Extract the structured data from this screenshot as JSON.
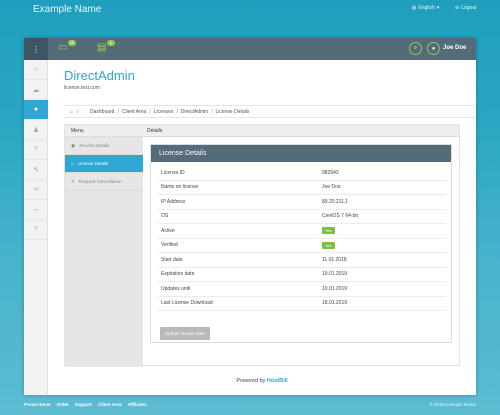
{
  "site": {
    "brand": "Example Name",
    "language": "English",
    "logout": "Logout"
  },
  "header": {
    "badge_one": "10",
    "badge_two": "0",
    "user_name": "Joe Doe"
  },
  "page": {
    "title": "DirectAdmin",
    "subtitle": "license.test.com",
    "breadcrumbs": [
      "Dashboard",
      "Client Area",
      "Licenses",
      "DirectAdmin",
      "License Details"
    ]
  },
  "panel": {
    "menu_label": "Menu",
    "details_label": "Details",
    "menu_items": [
      "Service Details",
      "License Details",
      "Request Cancellation"
    ]
  },
  "card": {
    "title": "License Details",
    "rows": [
      {
        "label": "License ID",
        "value": "982943"
      },
      {
        "label": "Name on license",
        "value": "Joe Doe"
      },
      {
        "label": "IP Address",
        "value": "89.20.211.1"
      },
      {
        "label": "OS",
        "value": "CentOS 7 64-bit"
      },
      {
        "label": "Active",
        "value": "Yes"
      },
      {
        "label": "Verified",
        "value": "Yes"
      },
      {
        "label": "Start date",
        "value": "11.01.2018"
      },
      {
        "label": "Expiration date",
        "value": "19.01.2019"
      },
      {
        "label": "Updates until",
        "value": "19.01.2019"
      },
      {
        "label": "Last License Download",
        "value": "18.01.2019"
      }
    ],
    "button": "Update license data"
  },
  "powered": {
    "prefix": "Powered by",
    "brand": "HostBill"
  },
  "footer": {
    "links": [
      "Portal Home",
      "Order",
      "Support",
      "Client Area",
      "Affiliates"
    ],
    "copyright": "© 2018 Example Name"
  },
  "colors": {
    "accent": "#2fa7d4",
    "header": "#546b79",
    "badge": "#8fc94f"
  }
}
